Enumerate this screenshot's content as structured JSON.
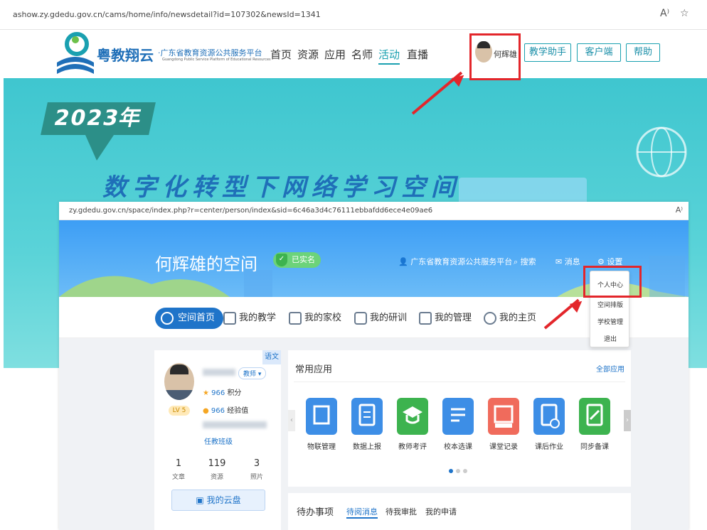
{
  "back_browser": {
    "url": "ashow.zy.gdedu.gov.cn/cams/home/info/newsdetail?id=107302&newsId=1341",
    "icons": [
      "read-aloud-icon",
      "favorite-star-icon"
    ]
  },
  "portal": {
    "logo_name": "粤教翔云",
    "logo_sub": "·广东省教育资源公共服务平台",
    "logo_en": "Guangdong Public Service Platform of Educational Resources",
    "nav": [
      "首页",
      "资源",
      "应用",
      "名师",
      "活动",
      "直播"
    ],
    "active_nav": "活动",
    "user_name": "何辉雄",
    "buttons": [
      "教学助手",
      "客户端",
      "帮助"
    ]
  },
  "banner": {
    "year": "2023年",
    "title": "数字化转型下网络学习空间"
  },
  "front_browser": {
    "url": "zy.gdedu.gov.cn/space/index.php?r=center/person/index&sid=6c46a3d4c76111ebbafdd6ece4e09ae6"
  },
  "space": {
    "title": "何辉雄的空间",
    "verified": "已实名",
    "top_links": [
      "广东省教育资源公共服务平台",
      "搜索",
      "消息",
      "设置"
    ],
    "tabs": [
      "空间首页",
      "我的教学",
      "我的家校",
      "我的研训",
      "我的管理",
      "我的主页"
    ],
    "active_tab": "空间首页",
    "dropdown": [
      "个人中心",
      "空间排版",
      "学校管理",
      "退出"
    ]
  },
  "profile": {
    "subject_tag": "语文",
    "role": "教师",
    "level": "LV 5",
    "points": "966",
    "points_label": "积分",
    "exp": "966",
    "exp_label": "经验值",
    "class_link": "任教班级",
    "stats": [
      {
        "value": "1",
        "label": "文章"
      },
      {
        "value": "119",
        "label": "资源"
      },
      {
        "value": "3",
        "label": "照片"
      }
    ],
    "cloud_button": "我的云盘"
  },
  "apps": {
    "title": "常用应用",
    "all_link": "全部应用",
    "items": [
      {
        "label": "物联管理",
        "color": "#3d8ee6"
      },
      {
        "label": "数据上报",
        "color": "#3d8ee6"
      },
      {
        "label": "教师考评",
        "color": "#3db34f"
      },
      {
        "label": "校本选课",
        "color": "#3d8ee6"
      },
      {
        "label": "课堂记录",
        "color": "#f06b5c"
      },
      {
        "label": "课后作业",
        "color": "#3d8ee6"
      },
      {
        "label": "同步备课",
        "color": "#3db34f"
      }
    ]
  },
  "todo": {
    "title": "待办事项",
    "tabs": [
      "待阅消息",
      "待我审批",
      "我的申请"
    ]
  }
}
